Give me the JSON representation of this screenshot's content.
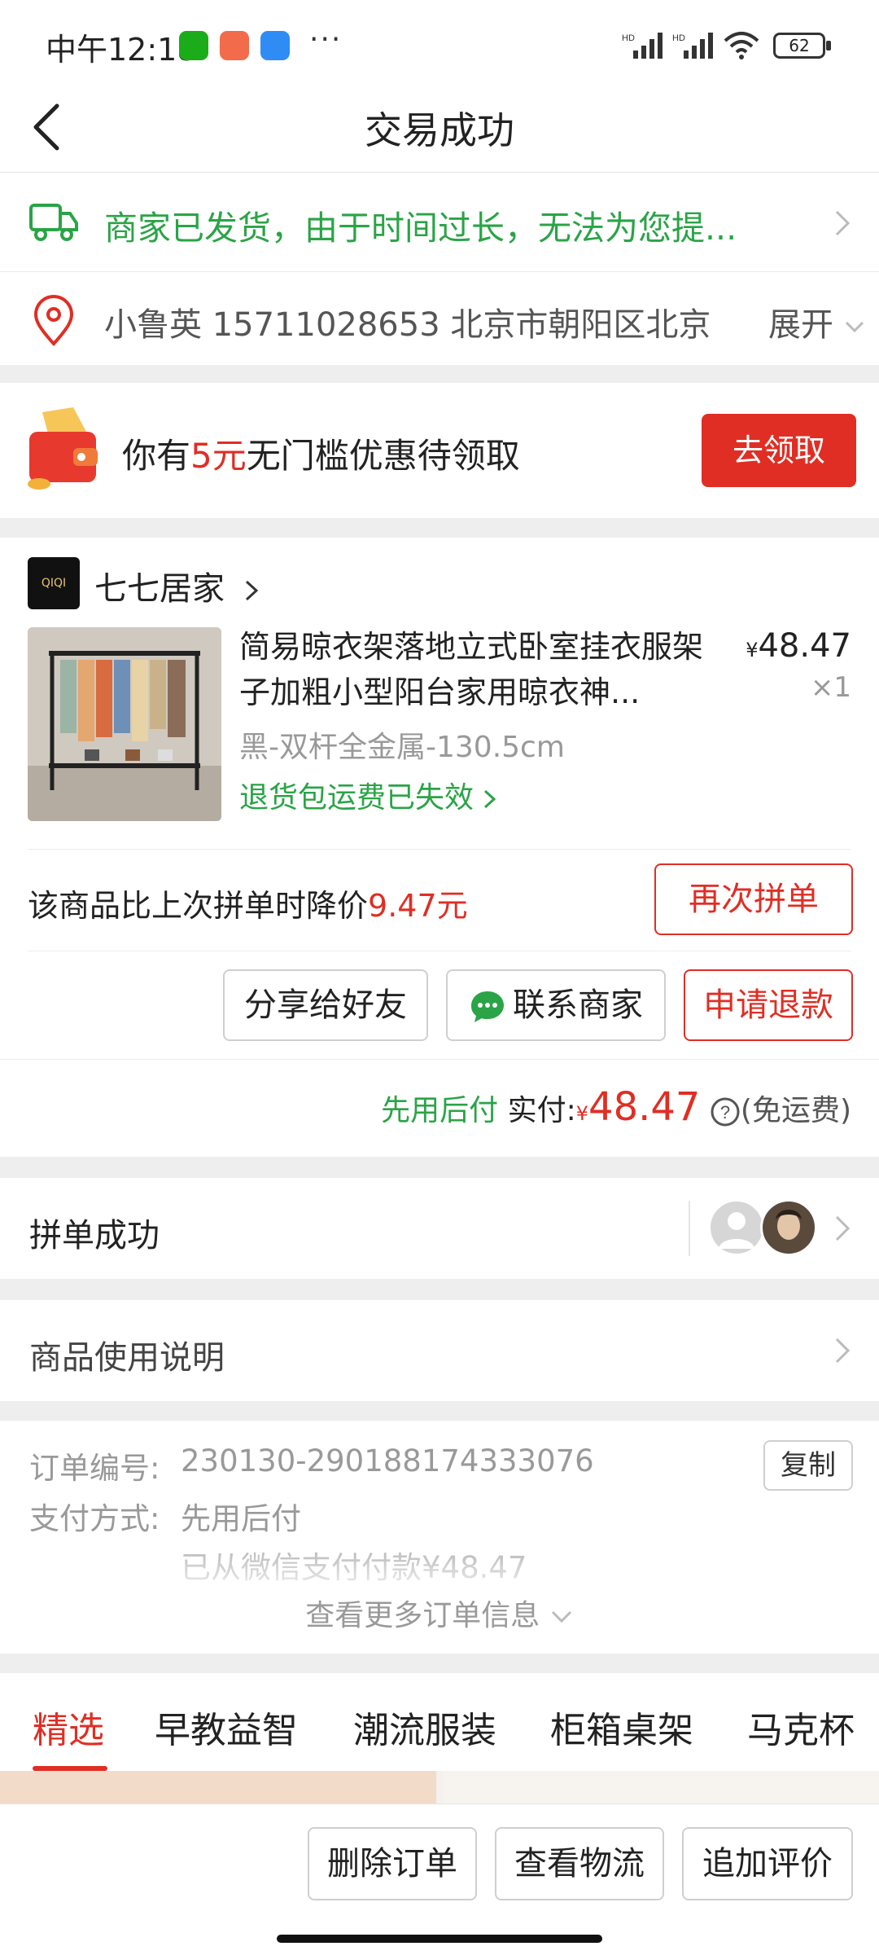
{
  "status_bar": {
    "time": "中午12:18",
    "battery": "62",
    "more": "···"
  },
  "nav": {
    "title": "交易成功"
  },
  "shipping": {
    "text": "商家已发货，由于时间过长，无法为您提..."
  },
  "address": {
    "text": "小鲁英  15711028653  北京市朝阳区北京",
    "expand_label": "展开"
  },
  "coupon": {
    "prefix": "你有",
    "amount": "5元",
    "suffix": "无门槛优惠待领取",
    "button_label": "去领取"
  },
  "order": {
    "shop_name": "七七居家",
    "shop_logo_text": "QIQI",
    "product_title": "简易晾衣架落地立式卧室挂衣服架子加粗小型阳台家用晾衣神...",
    "sku": "黑-双杆全金属-130.5cm",
    "policy": "退货包运费已失效",
    "price_symbol": "¥",
    "price": "48.47",
    "quantity": "×1",
    "drop_text_prefix": "该商品比上次拼单时降价",
    "drop_amount": "9.47元",
    "rebuy_label": "再次拼单",
    "share_label": "分享给好友",
    "contact_label": "联系商家",
    "refund_label": "申请退款",
    "pay_method_tag": "先用后付",
    "paid_label": "实付:",
    "paid_symbol": "¥",
    "paid_amount": "48.47",
    "shipping_note": "(免运费)"
  },
  "group": {
    "title": "拼单成功"
  },
  "usage": {
    "title": "商品使用说明"
  },
  "order_info": {
    "order_no_label": "订单编号:",
    "order_no": "230130-290188174333076",
    "copy_label": "复制",
    "pay_label": "支付方式:",
    "pay_value": "先用后付",
    "pay_detail": "已从微信支付付款¥48.47",
    "more_label": "查看更多订单信息"
  },
  "tabs": [
    "精选",
    "早教益智",
    "潮流服装",
    "柜箱桌架",
    "马克杯"
  ],
  "bottom_bar": {
    "delete_label": "删除订单",
    "logistics_label": "查看物流",
    "review_label": "追加评价"
  },
  "colors": {
    "accent_red": "#e02e24",
    "accent_green": "#2aa446"
  }
}
